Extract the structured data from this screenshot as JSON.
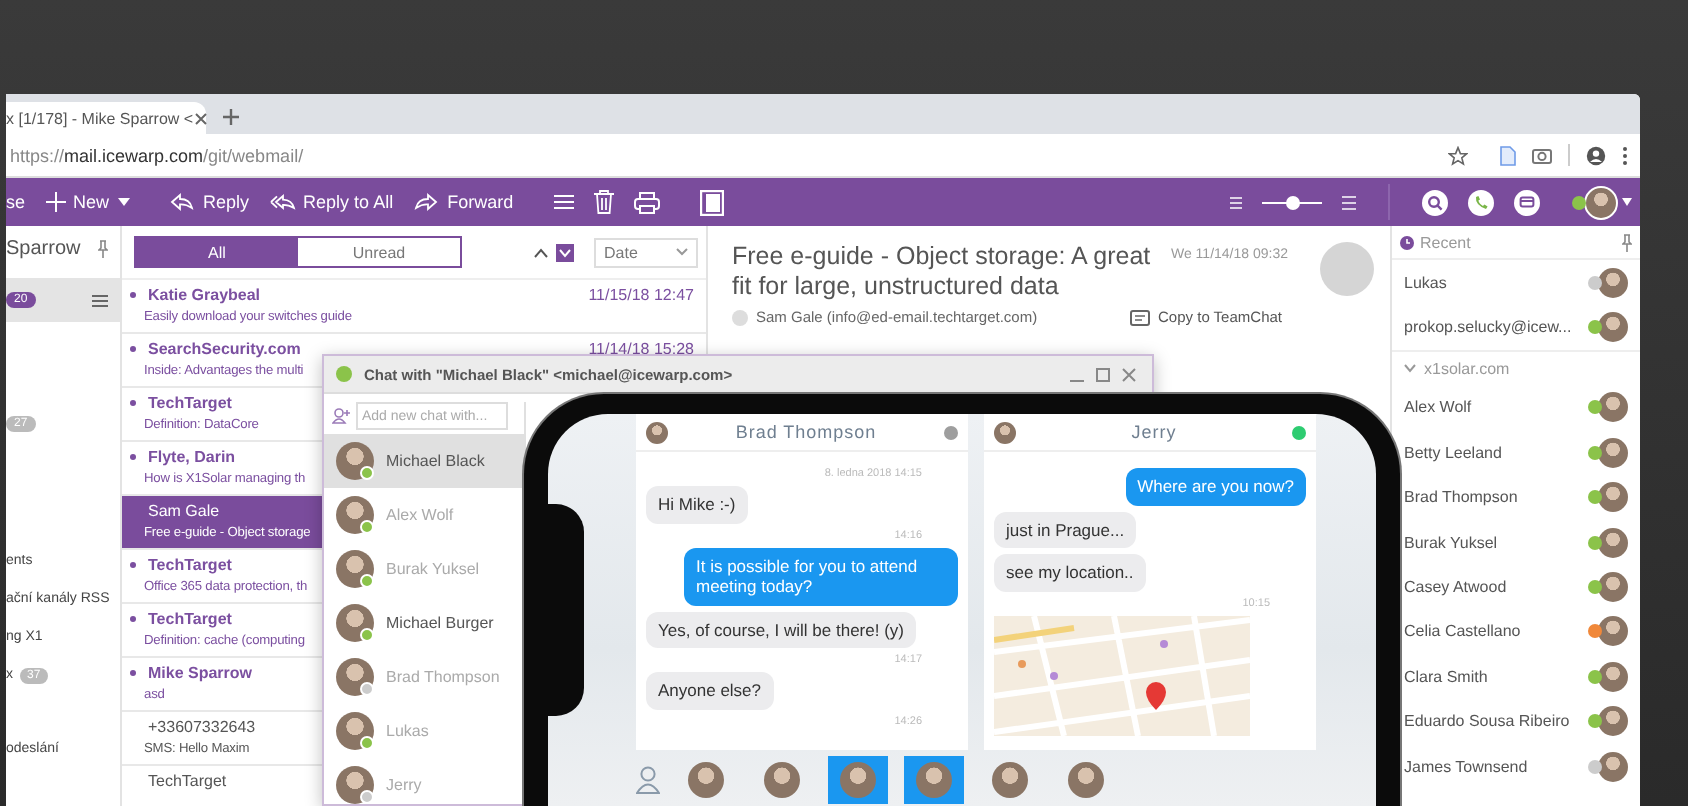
{
  "browser": {
    "tab_title": "x [1/178] - Mike Sparrow <",
    "url": "https://**mail.icewarp.com**/git/webmail/"
  },
  "toolbar": {
    "cut_label": "se",
    "new_label": "New",
    "actions": [
      "Reply",
      "Reply to All",
      "Forward"
    ],
    "density": {
      "level": 0.5
    }
  },
  "folders": {
    "title": "Sparrow",
    "items": [
      {
        "badge": "20",
        "selected": true
      },
      {
        "badge": "27",
        "selected": false
      },
      {
        "label": "ents",
        "selected": false
      },
      {
        "label": "ační kanály RSS",
        "selected": false
      },
      {
        "label": "ng X1",
        "selected": false
      },
      {
        "label": "x",
        "badge": "37",
        "selected": false
      },
      {
        "label": "odeslání",
        "selected": false
      }
    ]
  },
  "mail_list": {
    "filters": [
      {
        "label": "All",
        "selected": true
      },
      {
        "label": "Unread",
        "selected": false
      }
    ],
    "sort": "Date",
    "messages": [
      {
        "sender": "Katie Graybeal",
        "subject": "Easily download your switches guide",
        "date": "11/15/18 12:47",
        "unread": true,
        "selected": false
      },
      {
        "sender": "SearchSecurity.com",
        "subject": "Inside: Advantages the multi",
        "date": "11/14/18 15:28",
        "unread": true,
        "selected": false
      },
      {
        "sender": "TechTarget",
        "subject": "Definition: DataCore",
        "unread": true,
        "selected": false
      },
      {
        "sender": "Flyte, Darin",
        "subject": "How is X1Solar managing th",
        "unread": true,
        "selected": false
      },
      {
        "sender": "Sam Gale",
        "subject": "Free e-guide - Object storage",
        "unread": false,
        "selected": true
      },
      {
        "sender": "TechTarget",
        "subject": "Office 365 data protection, th",
        "unread": true,
        "selected": false
      },
      {
        "sender": "TechTarget",
        "subject": "Definition: cache (computing",
        "unread": true,
        "selected": false
      },
      {
        "sender": "Mike Sparrow",
        "subject": "asd",
        "unread": true,
        "selected": false
      },
      {
        "sender": "+33607332643",
        "subject": "SMS: Hello Maxim",
        "unread": false,
        "selected": false
      },
      {
        "sender": "TechTarget",
        "unread": false,
        "selected": false
      }
    ]
  },
  "reader": {
    "subject": "Free e-guide - Object storage: A great fit for large, unstructured data",
    "date": "We 11/14/18 09:32",
    "from": "Sam Gale (info@ed-email.techtarget.com)",
    "action": "Copy to TeamChat"
  },
  "contacts": {
    "title": "Recent",
    "recent": [
      {
        "name": "Lukas",
        "color": "#cccccc"
      },
      {
        "name": "prokop.selucky@icew...",
        "color": "#8bc34a"
      }
    ],
    "group": {
      "name": "x1solar.com",
      "expanded": true,
      "members": [
        {
          "name": "Alex Wolf",
          "color": "#8bc34a"
        },
        {
          "name": "Betty Leeland",
          "color": "#8bc34a"
        },
        {
          "name": "Brad Thompson",
          "color": "#8bc34a"
        },
        {
          "name": "Burak Yuksel",
          "color": "#8bc34a"
        },
        {
          "name": "Casey Atwood",
          "color": "#8bc34a"
        },
        {
          "name": "Celia Castellano",
          "color": "#f0883a"
        },
        {
          "name": "Clara Smith",
          "color": "#8bc34a"
        },
        {
          "name": "Eduardo Sousa Ribeiro",
          "color": "#8bc34a"
        },
        {
          "name": "James Townsend",
          "color": "#cccccc"
        }
      ]
    }
  },
  "chat_window": {
    "title": "Chat with \"Michael Black\" <michael@icewarp.com>",
    "search_placeholder": "Add new chat with...",
    "people": [
      {
        "name": "Michael Black",
        "selected": true,
        "dimmed": false,
        "color": "#8bc34a"
      },
      {
        "name": "Alex Wolf",
        "selected": false,
        "dimmed": true,
        "color": "#8bc34a"
      },
      {
        "name": "Burak Yuksel",
        "selected": false,
        "dimmed": true,
        "color": "#8bc34a"
      },
      {
        "name": "Michael Burger",
        "selected": false,
        "dimmed": false,
        "color": "#8bc34a"
      },
      {
        "name": "Brad Thompson",
        "selected": false,
        "dimmed": true,
        "color": "#cccccc"
      },
      {
        "name": "Lukas",
        "selected": false,
        "dimmed": true,
        "color": "#8bc34a"
      },
      {
        "name": "Jerry",
        "selected": false,
        "dimmed": true,
        "color": "#cccccc"
      }
    ]
  },
  "phone": {
    "conversations": [
      {
        "name": "Brad Thompson",
        "color": "#9e9e9e",
        "messages": [
          {
            "kind": "time",
            "text": "8. ledna 2018 14:15"
          },
          {
            "kind": "in",
            "text": "Hi Mike :-)"
          },
          {
            "kind": "time",
            "text": "14:16"
          },
          {
            "kind": "out",
            "text": "It is possible for you to attend meeting today?"
          },
          {
            "kind": "in",
            "text": "Yes, of course, I will be there! (y)"
          },
          {
            "kind": "time",
            "text": "14:17"
          },
          {
            "kind": "in",
            "text": "Anyone else?"
          },
          {
            "kind": "time",
            "text": "14:26"
          }
        ]
      },
      {
        "name": "Jerry",
        "color": "#2ecc71",
        "messages": [
          {
            "kind": "out",
            "text": "Where are you now?"
          },
          {
            "kind": "in",
            "text": "just in Prague..."
          },
          {
            "kind": "in",
            "text": "see my location.."
          },
          {
            "kind": "time",
            "text": "10:15"
          },
          {
            "kind": "map"
          }
        ]
      }
    ],
    "dock": [
      {
        "selected": false
      },
      {
        "selected": false
      },
      {
        "selected": true
      },
      {
        "selected": true
      },
      {
        "selected": false
      },
      {
        "selected": false
      }
    ]
  }
}
